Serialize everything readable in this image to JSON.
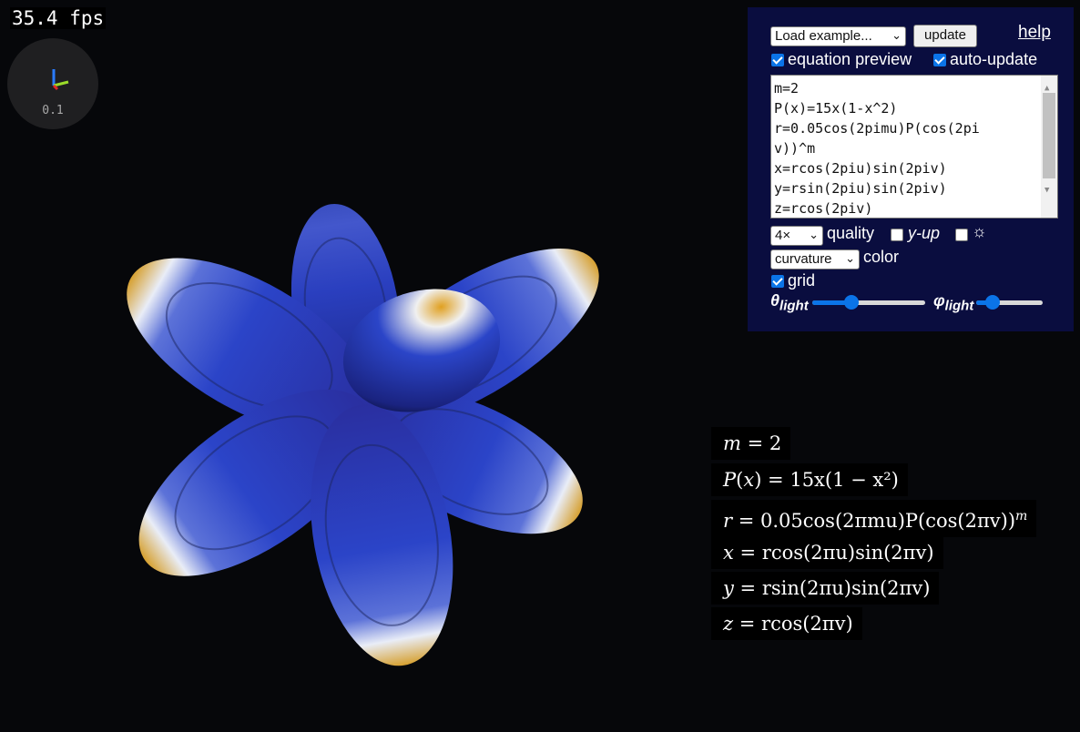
{
  "stats": {
    "fps": "35.4 fps"
  },
  "gizmo": {
    "scale": "0.1"
  },
  "panel": {
    "example_select": "Load example...",
    "update_label": "update",
    "help_label": "help",
    "equation_preview_label": "equation preview",
    "equation_preview_checked": true,
    "auto_update_label": "auto-update",
    "auto_update_checked": true,
    "code_lines": [
      "m=2",
      "P(x)=15x(1-x^2)",
      "r=0.05cos(2pimu)P(cos(2pi",
      "v))^m",
      "x=rcos(2piu)sin(2piv)",
      "y=rsin(2piu)sin(2piv)",
      "z=rcos(2piv)"
    ],
    "quality_select": "4×",
    "quality_label": "quality",
    "yup_label": "y-up",
    "yup_checked": false,
    "light_checked": false,
    "light_icon": "sun-icon",
    "color_select": "curvature",
    "color_label": "color",
    "grid_label": "grid",
    "grid_checked": true,
    "theta_light_symbol": "θ",
    "theta_light_sub": "light",
    "theta_light_value": 0.35,
    "phi_light_symbol": "φ",
    "phi_light_sub": "light",
    "phi_light_value": 0.25
  },
  "equations": {
    "eq1": {
      "lhs": "m",
      "rhs": "2"
    },
    "eq2": {
      "lhs": "P",
      "arg": "x",
      "rhs": "15x(1 − x²)"
    },
    "eq3": {
      "lhs": "r",
      "rhs": "0.05cos(2πmu)P(cos(2πv))",
      "sup": "m"
    },
    "eq4": {
      "lhs": "x",
      "rhs": "rcos(2πu)sin(2πv)"
    },
    "eq5": {
      "lhs": "y",
      "rhs": "rsin(2πu)sin(2πv)"
    },
    "eq6": {
      "lhs": "z",
      "rhs": "rcos(2πv)"
    }
  },
  "colors": {
    "petal_blue": "#2438c0",
    "petal_highlight": "#e8eef8",
    "petal_tip": "#e0a020",
    "panel_bg": "#0a0d3f",
    "background": "#06070a"
  }
}
